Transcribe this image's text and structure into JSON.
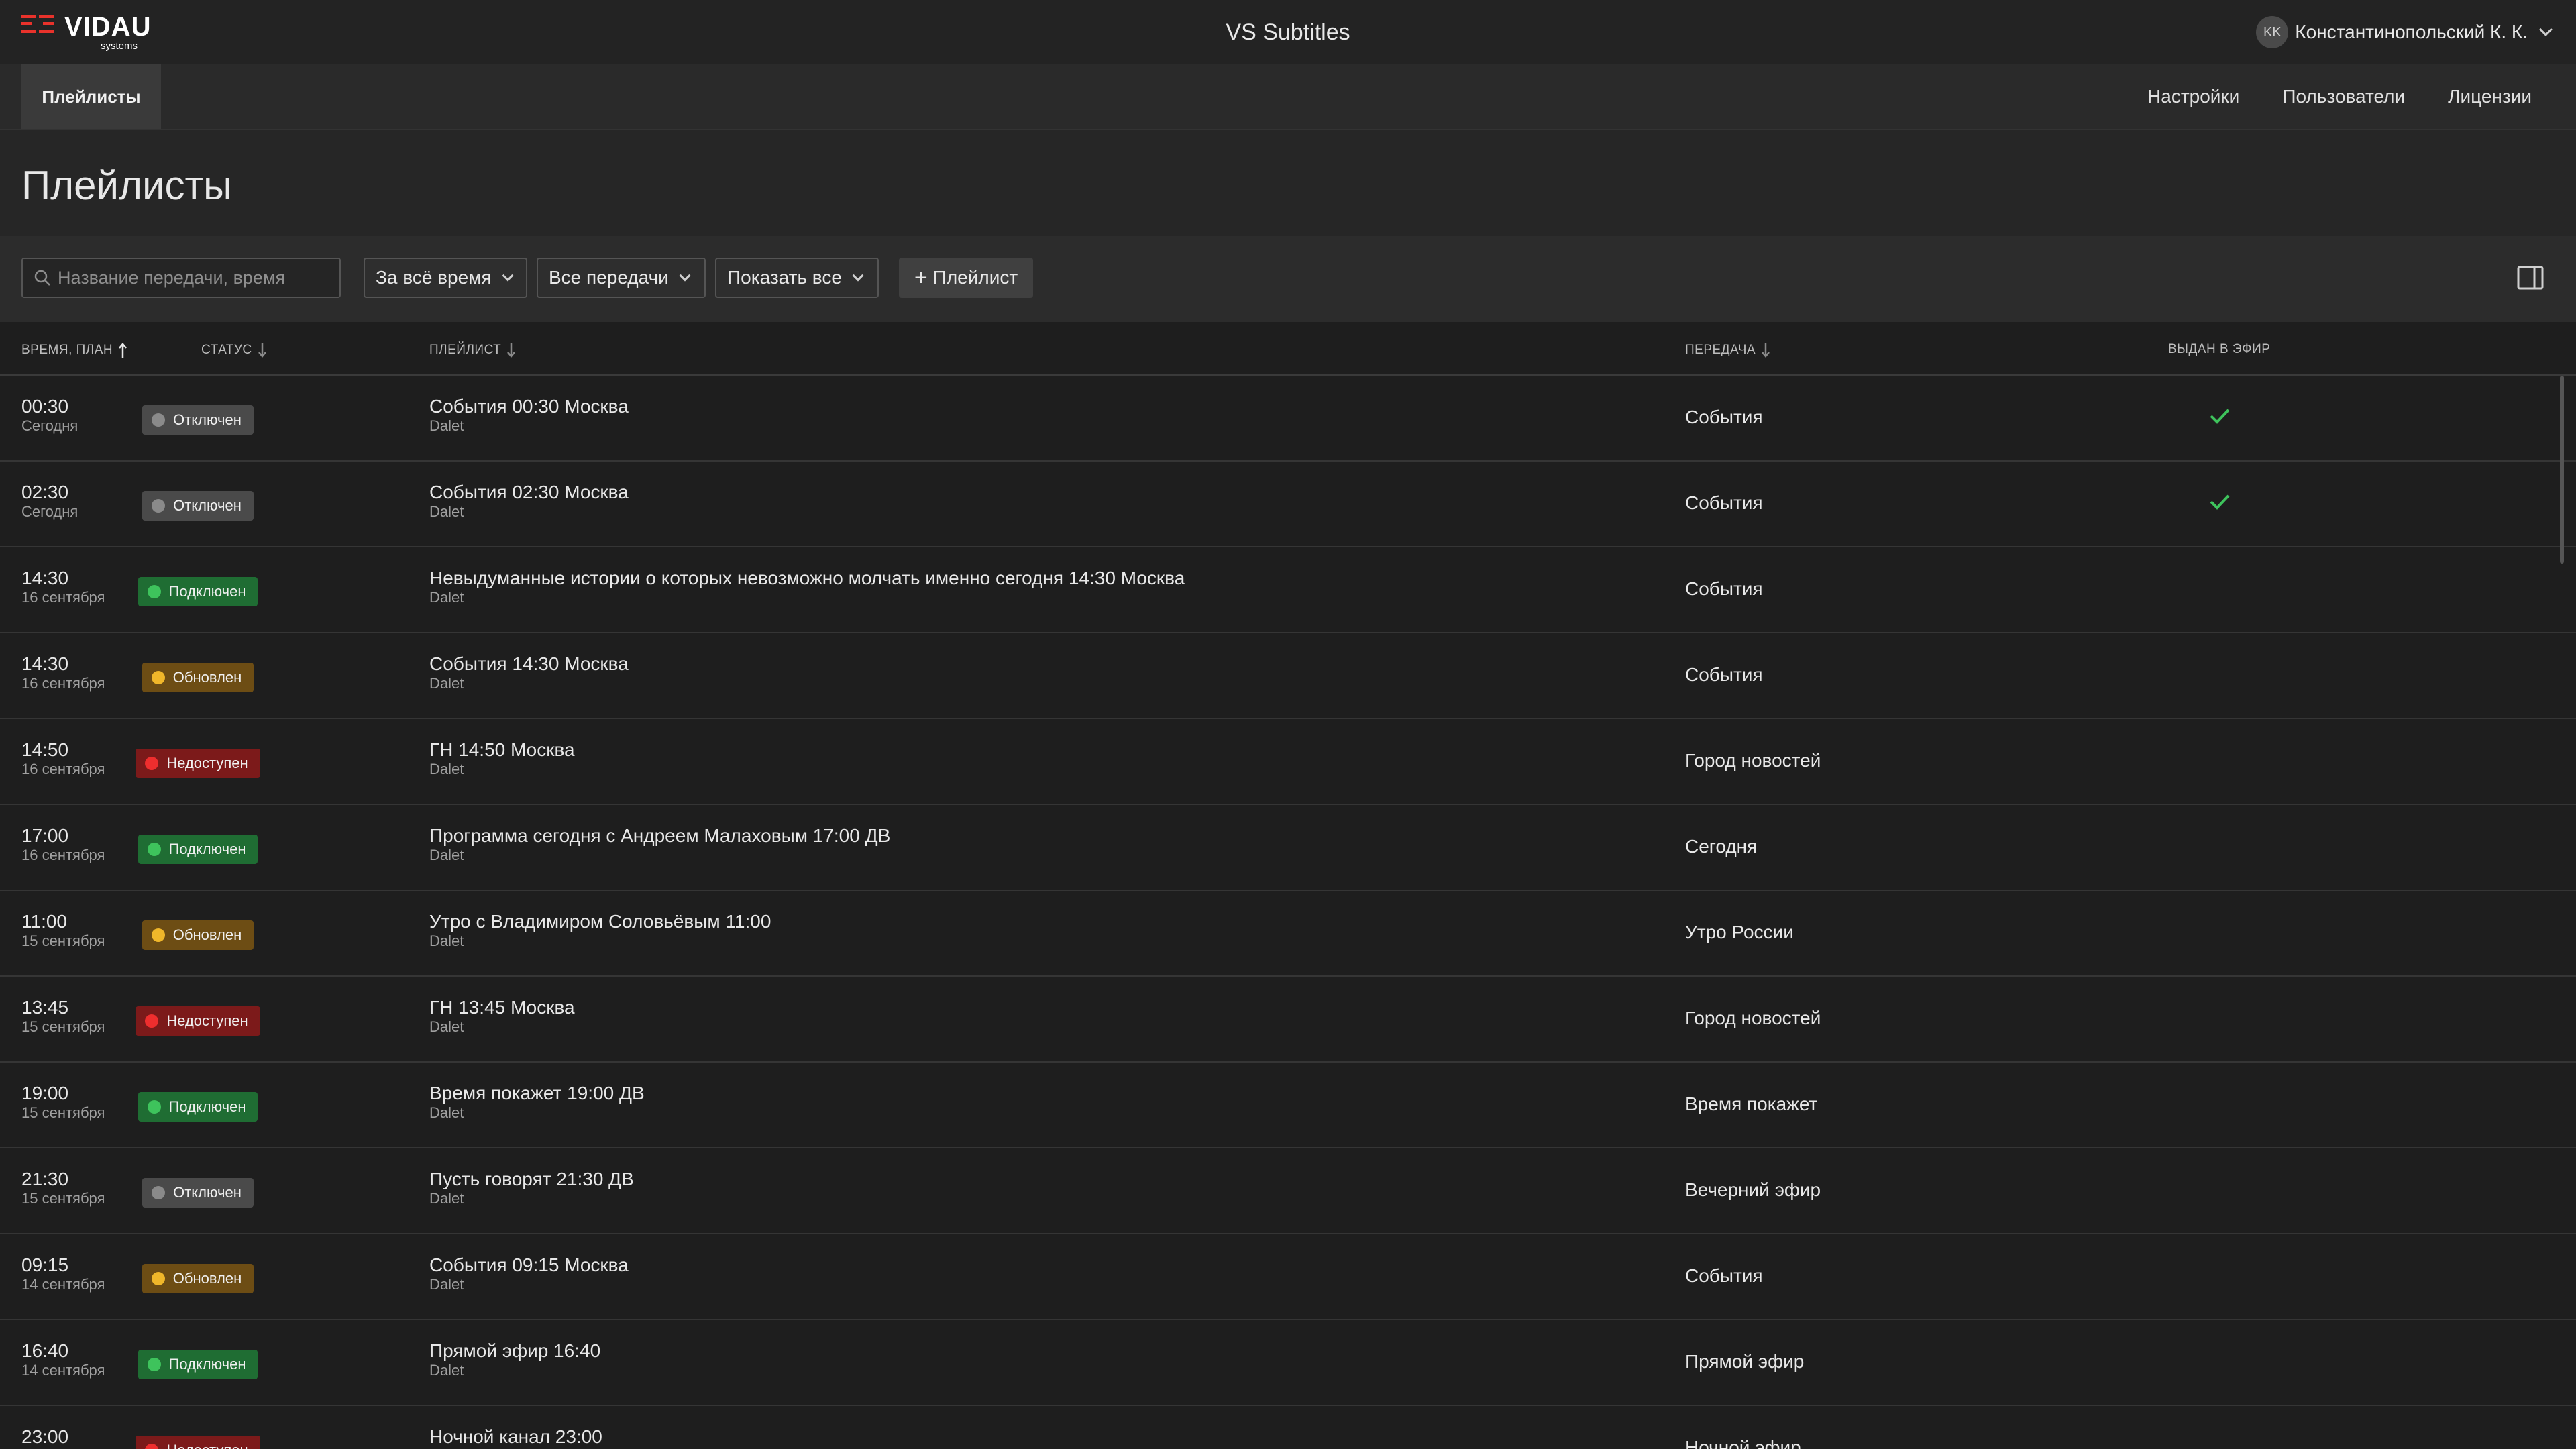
{
  "header": {
    "logo_text": "VIDAU",
    "logo_sub": "systems",
    "app_title": "VS Subtitles",
    "user_initials": "KK",
    "user_name": "Константинопольский К. К."
  },
  "nav": {
    "active_tab": "Плейлисты",
    "links": [
      "Настройки",
      "Пользователи",
      "Лицензии"
    ]
  },
  "page_title": "Плейлисты",
  "toolbar": {
    "search_placeholder": "Название передачи, время",
    "filter_period": "За всё время",
    "filter_shows": "Все передачи",
    "filter_show": "Показать все",
    "add_button": "Плейлист"
  },
  "columns": [
    "ВРЕМЯ, ПЛАН",
    "СТАТУС",
    "ПЛЕЙЛИСТ",
    "ПЕРЕДАЧА",
    "ВЫДАН В ЭФИР"
  ],
  "colors": {
    "accent_logo": "#e8322b",
    "check": "#3ec35c"
  },
  "rows": [
    {
      "time": "00:30",
      "date": "Сегодня",
      "status": "Отключен",
      "status_type": "off",
      "playlist": "События 00:30 Москва",
      "source": "Dalet",
      "show": "События",
      "aired": true
    },
    {
      "time": "02:30",
      "date": "Сегодня",
      "status": "Отключен",
      "status_type": "off",
      "playlist": "События 02:30 Москва",
      "source": "Dalet",
      "show": "События",
      "aired": true
    },
    {
      "time": "14:30",
      "date": "16 сентября",
      "status": "Подключен",
      "status_type": "on",
      "playlist": "Невыдуманные истории о которых невозможно молчать именно сегодня 14:30 Москва",
      "source": "Dalet",
      "show": "События",
      "aired": false
    },
    {
      "time": "14:30",
      "date": "16 сентября",
      "status": "Обновлен",
      "status_type": "upd",
      "playlist": "События 14:30 Москва",
      "source": "Dalet",
      "show": "События",
      "aired": false
    },
    {
      "time": "14:50",
      "date": "16 сентября",
      "status": "Недоступен",
      "status_type": "na",
      "playlist": "ГН 14:50 Москва",
      "source": "Dalet",
      "show": "Город новостей",
      "aired": false
    },
    {
      "time": "17:00",
      "date": "16 сентября",
      "status": "Подключен",
      "status_type": "on",
      "playlist": "Программа сегодня с Андреем Малаховым 17:00 ДВ",
      "source": "Dalet",
      "show": "Сегодня",
      "aired": false
    },
    {
      "time": "11:00",
      "date": "15 сентября",
      "status": "Обновлен",
      "status_type": "upd",
      "playlist": "Утро с Владимиром Соловьёвым 11:00",
      "source": "Dalet",
      "show": "Утро России",
      "aired": false
    },
    {
      "time": "13:45",
      "date": "15 сентября",
      "status": "Недоступен",
      "status_type": "na",
      "playlist": "ГН 13:45 Москва",
      "source": "Dalet",
      "show": "Город новостей",
      "aired": false
    },
    {
      "time": "19:00",
      "date": "15 сентября",
      "status": "Подключен",
      "status_type": "on",
      "playlist": "Время покажет 19:00 ДВ",
      "source": "Dalet",
      "show": "Время покажет",
      "aired": false
    },
    {
      "time": "21:30",
      "date": "15 сентября",
      "status": "Отключен",
      "status_type": "off",
      "playlist": "Пусть говорят 21:30 ДВ",
      "source": "Dalet",
      "show": "Вечерний эфир",
      "aired": false
    },
    {
      "time": "09:15",
      "date": "14 сентября",
      "status": "Обновлен",
      "status_type": "upd",
      "playlist": "События 09:15 Москва",
      "source": "Dalet",
      "show": "События",
      "aired": false
    },
    {
      "time": "16:40",
      "date": "14 сентября",
      "status": "Подключен",
      "status_type": "on",
      "playlist": "Прямой эфир 16:40",
      "source": "Dalet",
      "show": "Прямой эфир",
      "aired": false
    },
    {
      "time": "23:00",
      "date": "",
      "status": "Недоступен",
      "status_type": "na",
      "playlist": "Ночной канал 23:00",
      "source": "",
      "show": "Ночной эфир",
      "aired": false
    }
  ]
}
